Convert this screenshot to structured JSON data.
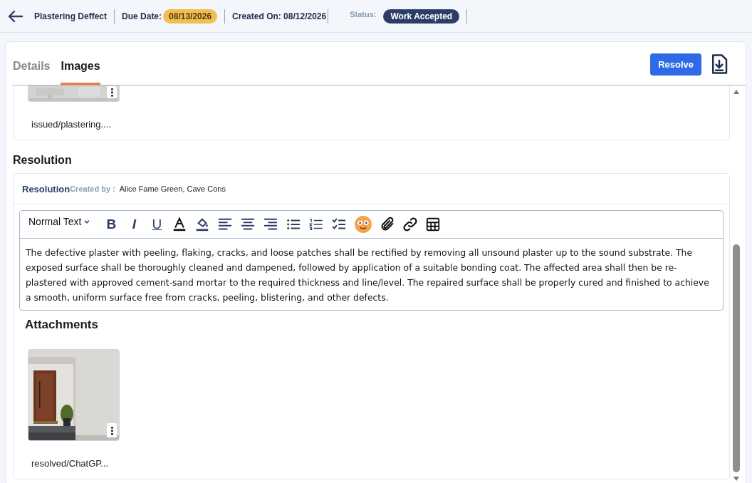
{
  "header": {
    "title": "Plastering Deffect",
    "due_date_label": "Due Date:",
    "due_date": "08/13/2026",
    "created_on": "Created On: 08/12/2026",
    "status_label": "Status:",
    "status": "Work Accepted"
  },
  "tabs": [
    {
      "label": "Details",
      "selected": false
    },
    {
      "label": "Images",
      "selected": true
    }
  ],
  "resolve_button": "Resolve",
  "issued_attachment": {
    "filename": "issued/plastering...."
  },
  "resolution": {
    "heading": "Resolution",
    "card_title": "Resolution",
    "created_by_label": "Created by :",
    "created_by": "Alice Fame Green, Cave Cons",
    "editor": {
      "format": "Normal Text",
      "toolbar": [
        {
          "kind": "bold",
          "label": "B"
        },
        {
          "kind": "italic",
          "label": "I"
        },
        {
          "kind": "underline",
          "label": "U"
        },
        {
          "kind": "text-color"
        },
        {
          "kind": "highlight"
        },
        {
          "kind": "align-left"
        },
        {
          "kind": "align-center"
        },
        {
          "kind": "align-right"
        },
        {
          "kind": "bullet-list"
        },
        {
          "kind": "numbered-list"
        },
        {
          "kind": "checklist"
        },
        {
          "kind": "emoji"
        },
        {
          "kind": "attach"
        },
        {
          "kind": "link"
        },
        {
          "kind": "table"
        }
      ],
      "text": "The defective plaster with peeling, flaking, cracks, and loose patches shall be rectified by removing all unsound plaster up to the sound substrate. The exposed surface shall be thoroughly cleaned and dampened, followed by application of a suitable bonding coat. The affected area shall then be re-plastered with approved cement-sand mortar to the required thickness and line/level. The repaired surface shall be properly cured and finished to achieve a smooth, uniform surface free from cracks, peeling, blistering, and other defects."
    },
    "attachments_heading": "Attachments",
    "attachments": [
      {
        "filename": "resolved/ChatGP..."
      }
    ]
  }
}
